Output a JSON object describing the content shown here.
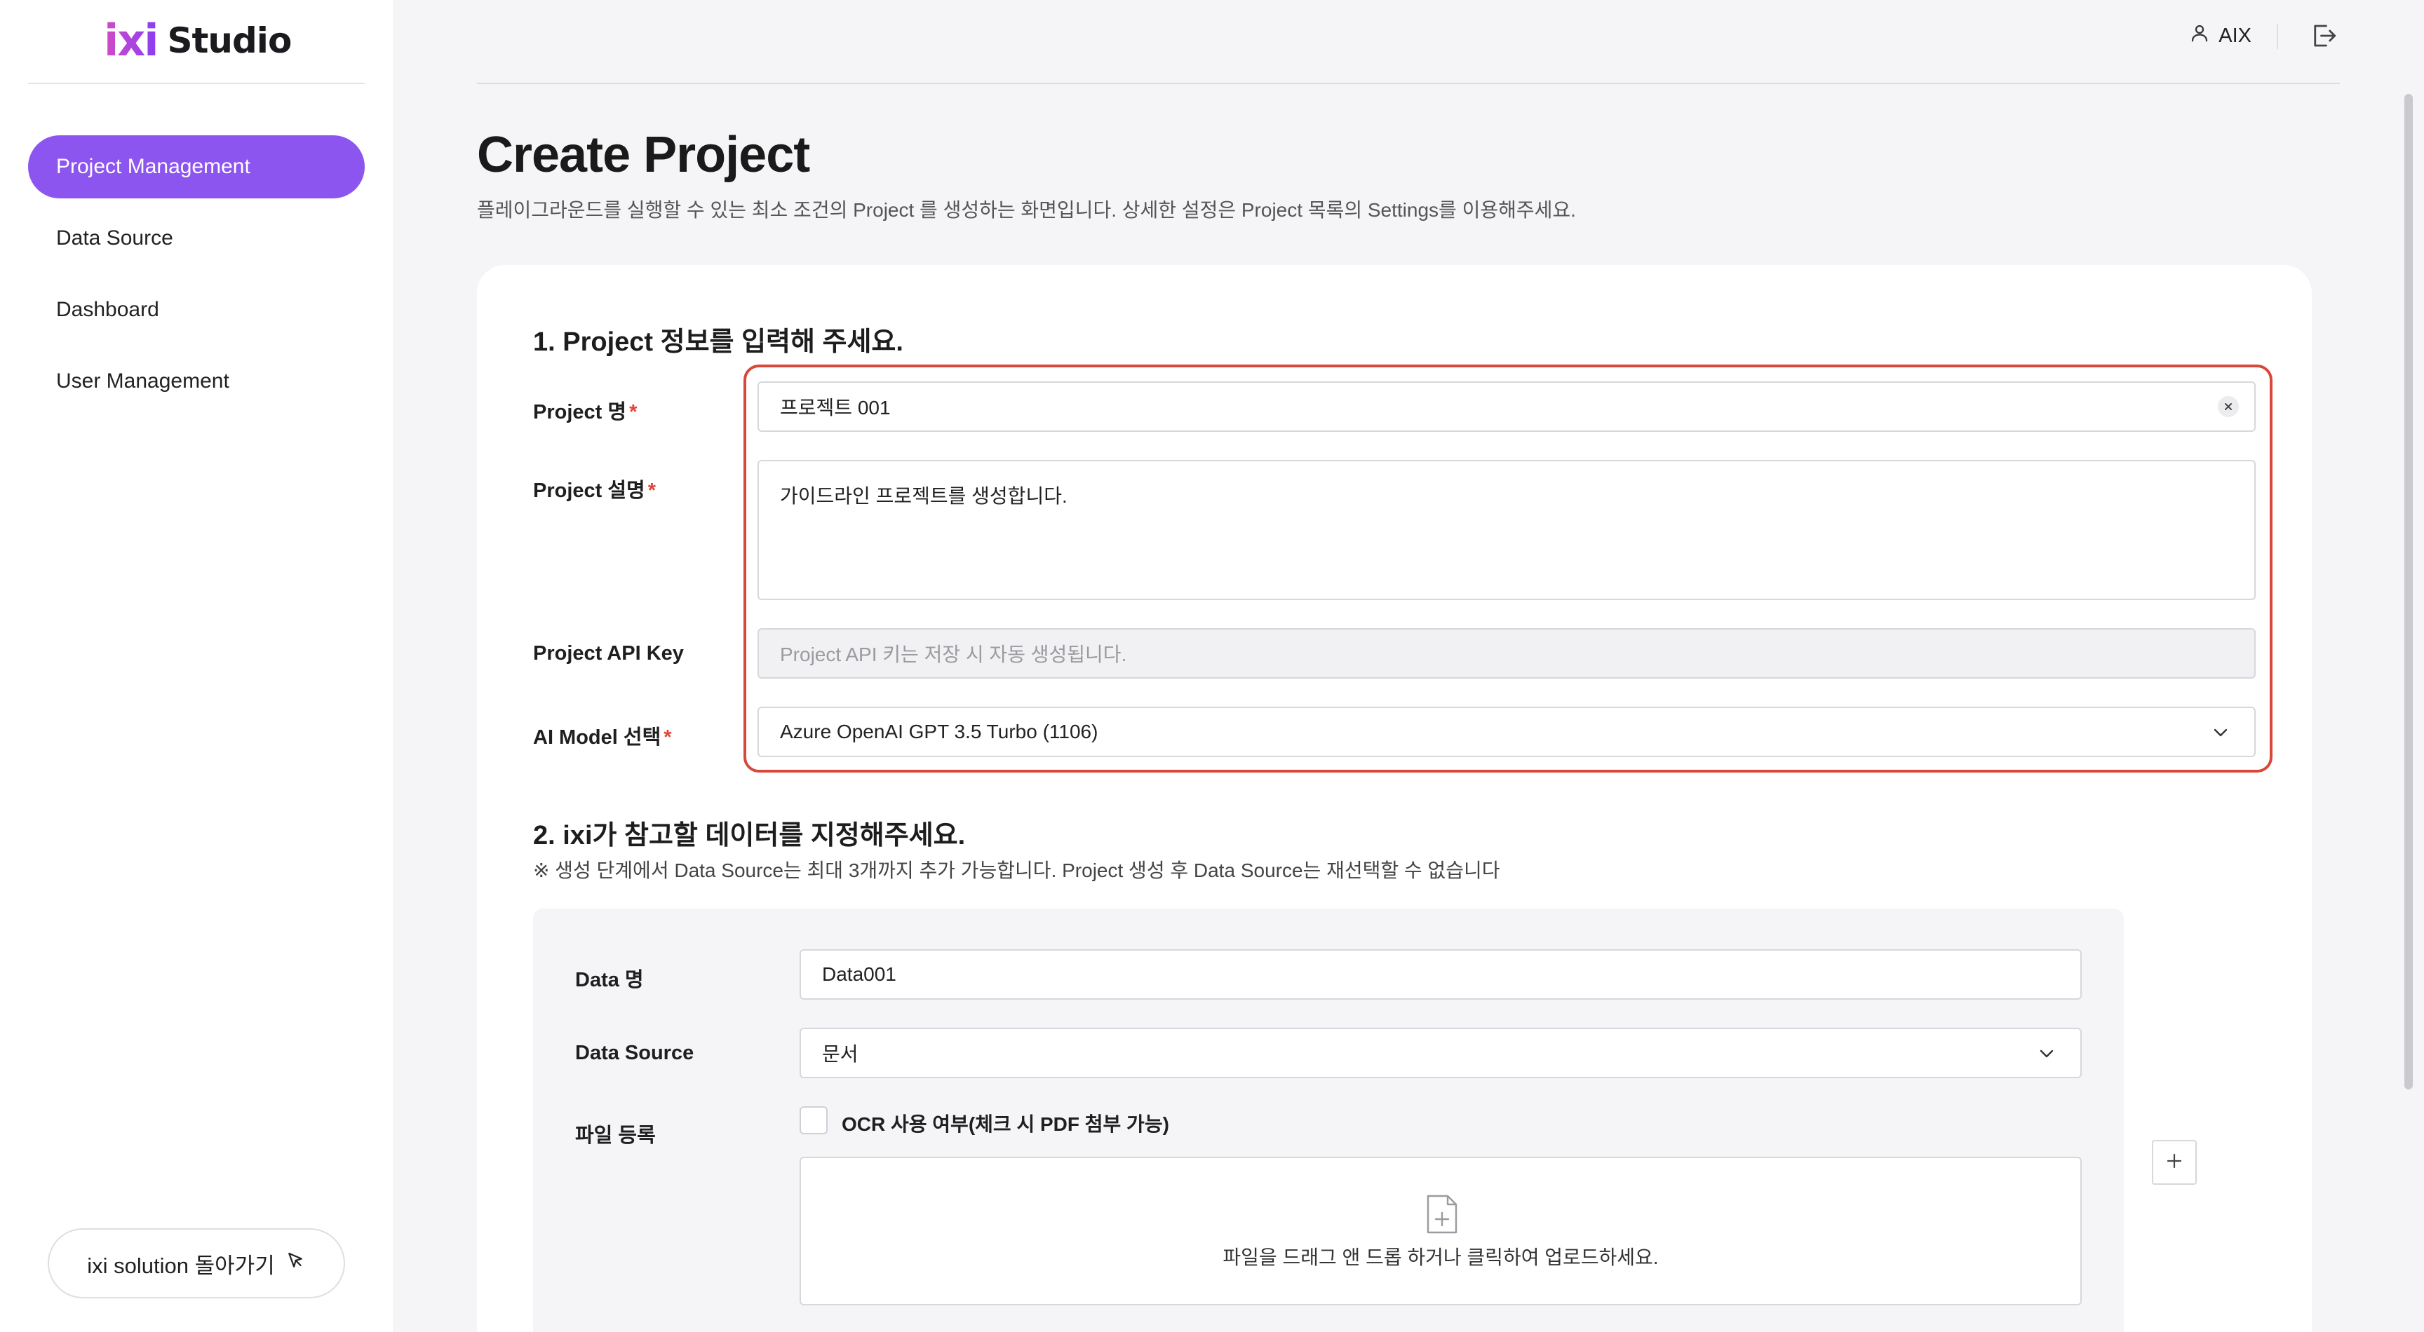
{
  "brand": {
    "mark": "ixi",
    "name": "Studio",
    "mark_gradient": [
      "#d14cc4",
      "#8a3df5"
    ]
  },
  "sidebar": {
    "items": [
      {
        "label": "Project Management",
        "active": true
      },
      {
        "label": "Data Source",
        "active": false
      },
      {
        "label": "Dashboard",
        "active": false
      },
      {
        "label": "User Management",
        "active": false
      }
    ],
    "back_button": "ixi solution 돌아가기"
  },
  "header": {
    "user": "AIX"
  },
  "page": {
    "title": "Create Project",
    "description": "플레이그라운드를 실행할 수 있는 최소 조건의 Project 를 생성하는 화면입니다. 상세한 설정은 Project 목록의 Settings를 이용해주세요."
  },
  "section1": {
    "title": "1. Project 정보를 입력해 주세요.",
    "fields": {
      "name": {
        "label": "Project 명",
        "value": "프로젝트 001",
        "required": true
      },
      "description": {
        "label": "Project 설명",
        "value": "가이드라인 프로젝트를 생성합니다.",
        "required": true
      },
      "api_key": {
        "label": "Project API Key",
        "placeholder": "Project API 키는 저장 시 자동 생성됩니다."
      },
      "model": {
        "label": "AI Model 선택",
        "value": "Azure OpenAI GPT 3.5 Turbo (1106)",
        "required": true
      }
    }
  },
  "section2": {
    "title": "2. ixi가 참고할 데이터를 지정해주세요.",
    "note": "※ 생성 단계에서 Data Source는 최대 3개까지 추가 가능합니다. Project 생성 후 Data Source는 재선택할 수 없습니다",
    "data_name": {
      "label": "Data 명",
      "value": "Data001"
    },
    "data_source": {
      "label": "Data Source",
      "value": "문서"
    },
    "file": {
      "label": "파일 등록",
      "ocr_label": "OCR 사용 여부(체크 시 PDF 첨부 가능)",
      "ocr_checked": false,
      "dropzone_text": "파일을 드래그 앤 드롭 하거나 클릭하여 업로드하세요."
    }
  },
  "colors": {
    "accent": "#8d55f0",
    "required": "#e0443a",
    "highlight": "#d9463a"
  }
}
